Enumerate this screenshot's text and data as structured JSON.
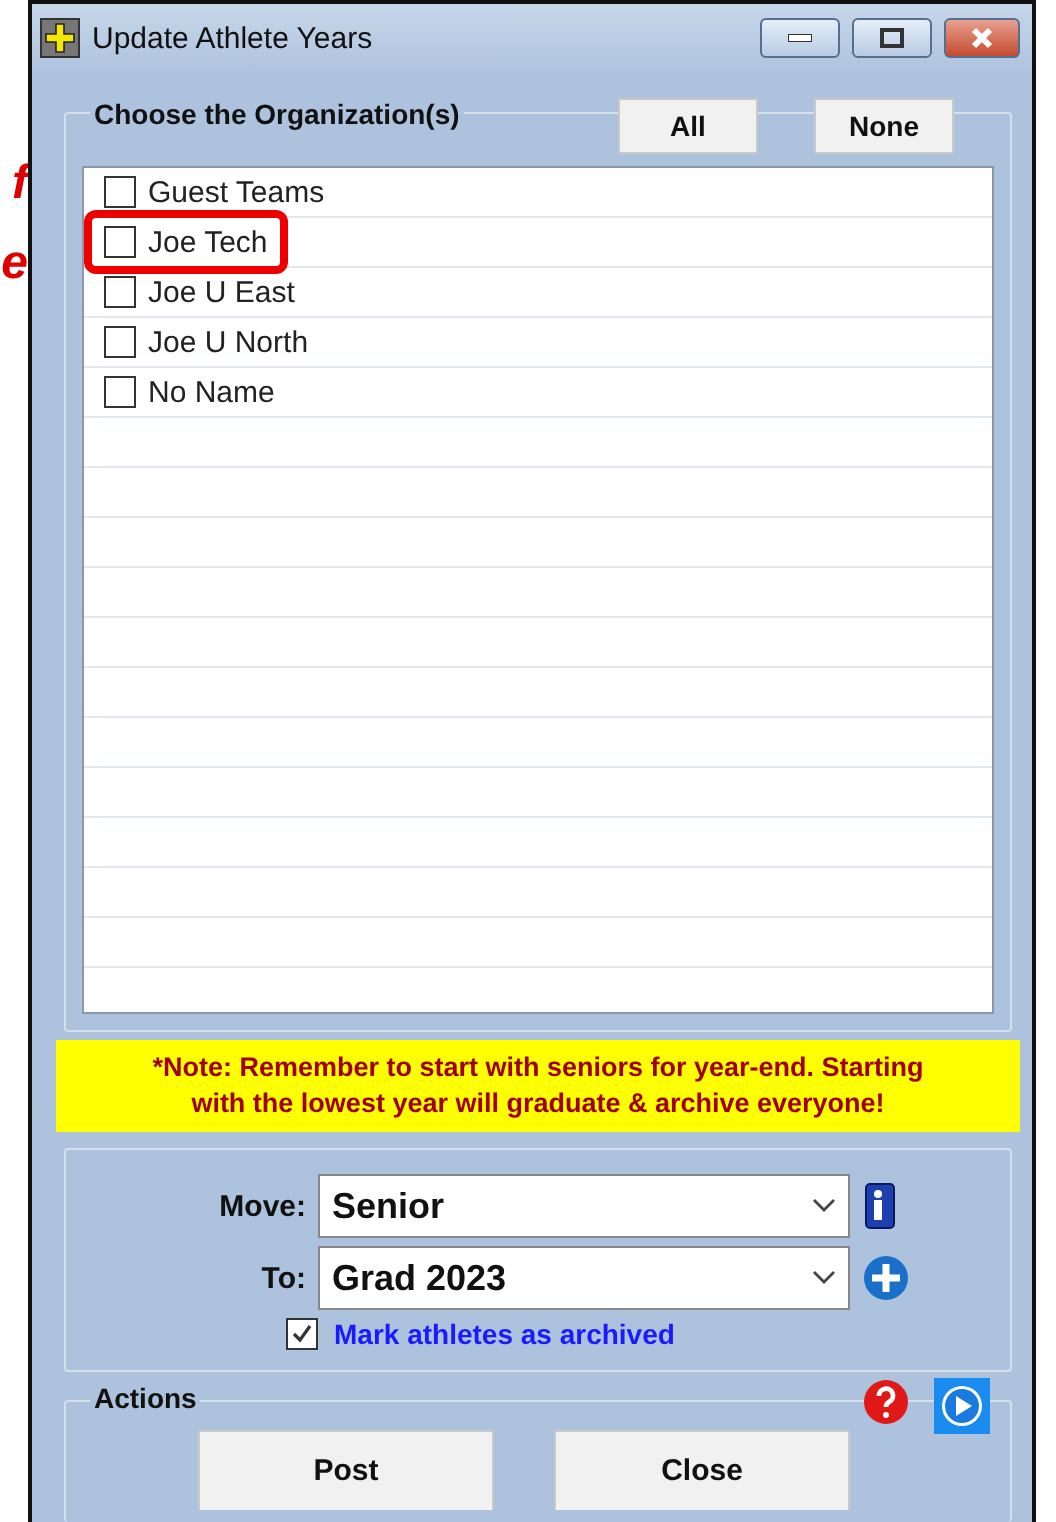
{
  "annotation_letters": [
    "f",
    "e"
  ],
  "window": {
    "title": "Update Athlete Years"
  },
  "organizations": {
    "title": "Choose the Organization(s)",
    "buttons": [
      "All",
      "None"
    ],
    "items": [
      {
        "label": "Guest Teams",
        "checked": false,
        "highlighted": false
      },
      {
        "label": "Joe Tech",
        "checked": false,
        "highlighted": true
      },
      {
        "label": "Joe U East",
        "checked": false,
        "highlighted": false
      },
      {
        "label": "Joe U North",
        "checked": false,
        "highlighted": false
      },
      {
        "label": "No Name",
        "checked": false,
        "highlighted": false
      }
    ]
  },
  "note": [
    "*Note:  Remember to start with seniors for year-end.  Starting",
    "with the lowest year will graduate & archive everyone!"
  ],
  "move": {
    "label": "Move:",
    "value": "Senior"
  },
  "to": {
    "label": "To:",
    "value": "Grad 2023"
  },
  "archive": {
    "label": "Mark athletes as archived",
    "checked": true
  },
  "actions": {
    "title": "Actions",
    "buttons": [
      "Post",
      "Close"
    ]
  }
}
